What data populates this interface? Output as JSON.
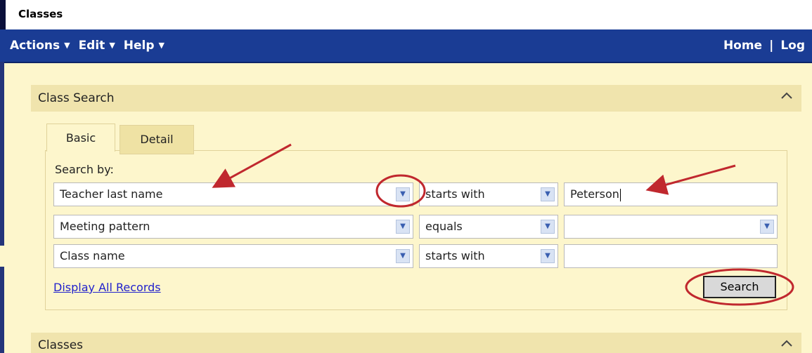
{
  "window": {
    "title": "Classes"
  },
  "nav": {
    "actions": "Actions",
    "edit": "Edit",
    "help": "Help",
    "home": "Home",
    "separator": "|",
    "log": "Log"
  },
  "class_search": {
    "title": "Class Search",
    "tabs": [
      {
        "label": "Basic",
        "selected": true
      },
      {
        "label": "Detail",
        "selected": false
      }
    ],
    "search_by_label": "Search by:",
    "rows": [
      {
        "field": "Teacher last name",
        "operator": "starts with",
        "value": "Peterson"
      },
      {
        "field": "Meeting pattern",
        "operator": "equals",
        "value": ""
      },
      {
        "field": "Class name",
        "operator": "starts with",
        "value": ""
      }
    ],
    "display_all_link": "Display All Records",
    "search_button": "Search"
  },
  "classes_panel": {
    "title": "Classes"
  },
  "icons": {
    "dropdown": "chevron-down-icon",
    "collapse": "chevron-up-icon",
    "menu_caret": "caret-down-icon"
  },
  "colors": {
    "navbar": "#1a3c94",
    "background": "#fdf6cc",
    "panel_header": "#f0e4ad",
    "annotation": "#c0282e"
  }
}
